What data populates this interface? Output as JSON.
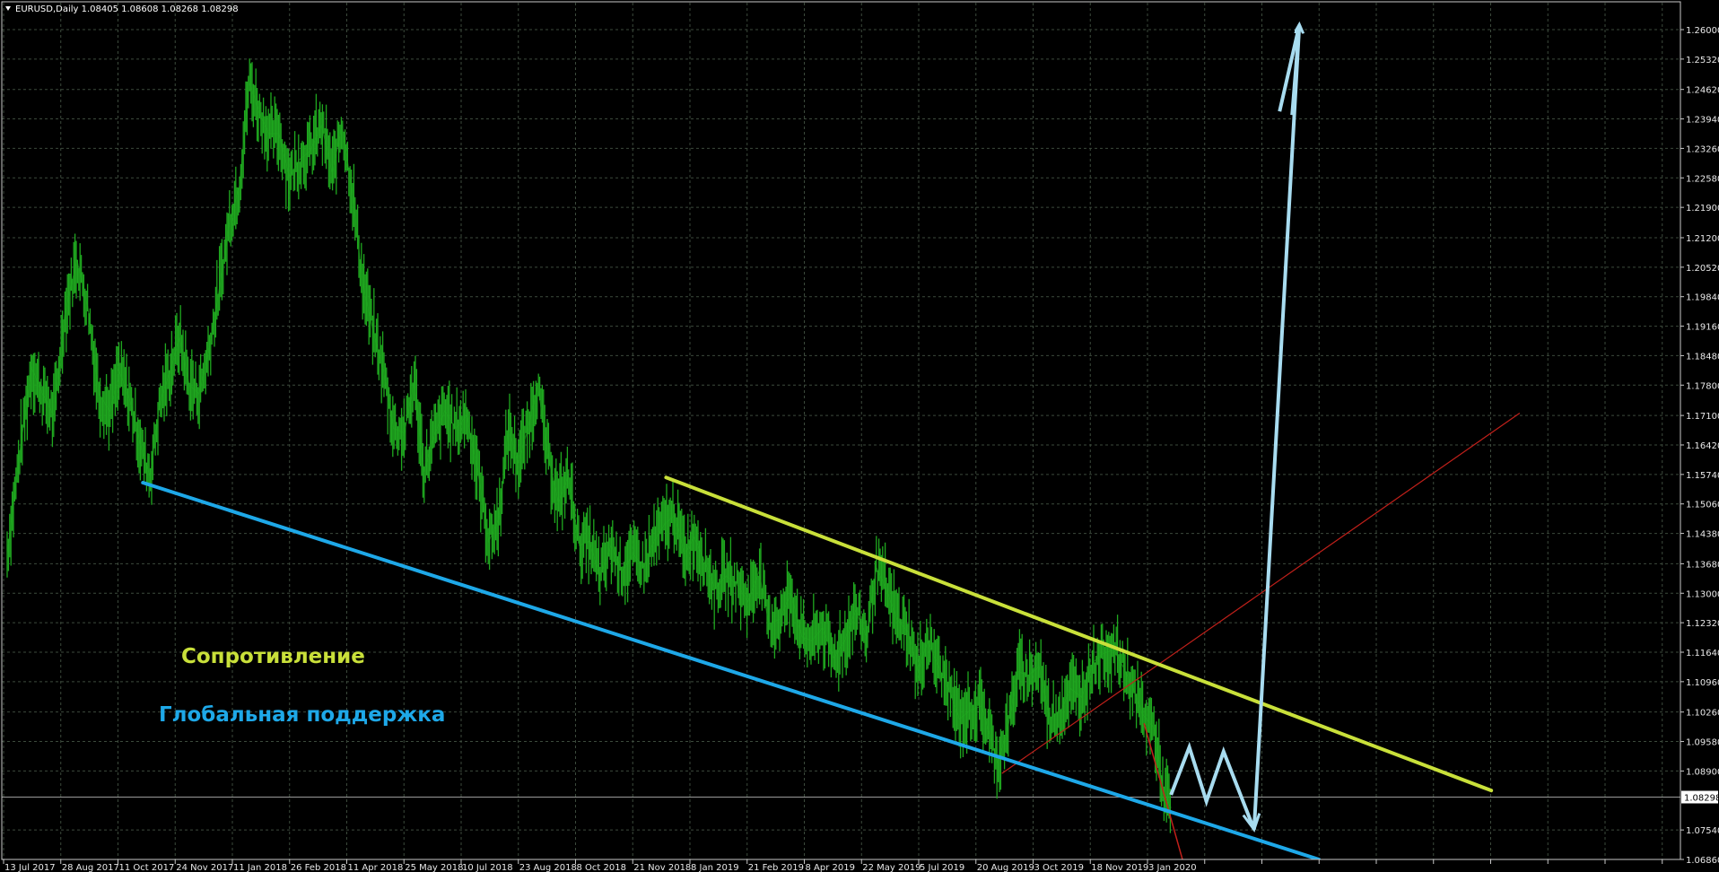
{
  "header": {
    "symbol_line": "EURUSD,Daily  1.08405 1.08608 1.08268 1.08298"
  },
  "colors": {
    "background": "#000000",
    "grid": "#3c4a3c",
    "axis": "#c8c8c8",
    "price": "#1fa81f",
    "resistance": "#c9e03a",
    "support": "#1ea8e8",
    "forecast": "#a8dcf0",
    "red_line": "#c0201a",
    "current_price_line": "#9a9a9a"
  },
  "annotations": {
    "resistance": "Сопротивление",
    "support": "Глобальная поддержка"
  },
  "current_price": "1.08298",
  "chart_data": {
    "type": "line",
    "symbol": "EURUSD",
    "timeframe": "Daily",
    "ohlc_last": {
      "open": 1.08405,
      "high": 1.08608,
      "low": 1.08268,
      "close": 1.08298
    },
    "y_ticks": [
      "1.26000",
      "1.25320",
      "1.24620",
      "1.23940",
      "1.23260",
      "1.22580",
      "1.21900",
      "1.21200",
      "1.20520",
      "1.19840",
      "1.19160",
      "1.18480",
      "1.17800",
      "1.17100",
      "1.16420",
      "1.15740",
      "1.15060",
      "1.14380",
      "1.13680",
      "1.13000",
      "1.12320",
      "1.11640",
      "1.10960",
      "1.10260",
      "1.09580",
      "1.08900",
      "1.08298",
      "1.07540",
      "1.06860"
    ],
    "x_ticks": [
      "13 Jul 2017",
      "28 Aug 2017",
      "11 Oct 2017",
      "24 Nov 2017",
      "11 Jan 2018",
      "26 Feb 2018",
      "11 Apr 2018",
      "25 May 2018",
      "10 Jul 2018",
      "23 Aug 2018",
      "8 Oct 2018",
      "21 Nov 2018",
      "8 Jan 2019",
      "21 Feb 2019",
      "8 Apr 2019",
      "22 May 2019",
      "5 Jul 2019",
      "20 Aug 2019",
      "3 Oct 2019",
      "18 Nov 2019",
      "3 Jan 2020"
    ],
    "ylim": [
      1.0686,
      1.2628
    ],
    "grid": true,
    "series": [
      {
        "values": [
          [
            "2017-07-13",
            1.139
          ],
          [
            "2017-07-24",
            1.164
          ],
          [
            "2017-08-02",
            1.182
          ],
          [
            "2017-08-11",
            1.176
          ],
          [
            "2017-08-20",
            1.171
          ],
          [
            "2017-08-29",
            1.194
          ],
          [
            "2017-09-08",
            1.207
          ],
          [
            "2017-09-17",
            1.196
          ],
          [
            "2017-09-26",
            1.176
          ],
          [
            "2017-10-05",
            1.172
          ],
          [
            "2017-10-13",
            1.181
          ],
          [
            "2017-10-22",
            1.174
          ],
          [
            "2017-10-31",
            1.163
          ],
          [
            "2017-11-07",
            1.157
          ],
          [
            "2017-11-15",
            1.174
          ],
          [
            "2017-11-23",
            1.181
          ],
          [
            "2017-12-01",
            1.189
          ],
          [
            "2017-12-09",
            1.178
          ],
          [
            "2017-12-17",
            1.176
          ],
          [
            "2017-12-25",
            1.186
          ],
          [
            "2018-01-03",
            1.201
          ],
          [
            "2018-01-11",
            1.216
          ],
          [
            "2018-01-19",
            1.224
          ],
          [
            "2018-01-27",
            1.248
          ],
          [
            "2018-02-04",
            1.241
          ],
          [
            "2018-02-12",
            1.236
          ],
          [
            "2018-02-20",
            1.236
          ],
          [
            "2018-03-01",
            1.226
          ],
          [
            "2018-03-09",
            1.23
          ],
          [
            "2018-03-18",
            1.232
          ],
          [
            "2018-03-27",
            1.238
          ],
          [
            "2018-04-05",
            1.227
          ],
          [
            "2018-04-13",
            1.238
          ],
          [
            "2018-04-22",
            1.221
          ],
          [
            "2018-04-30",
            1.201
          ],
          [
            "2018-05-08",
            1.191
          ],
          [
            "2018-05-17",
            1.181
          ],
          [
            "2018-05-25",
            1.168
          ],
          [
            "2018-06-03",
            1.167
          ],
          [
            "2018-06-11",
            1.179
          ],
          [
            "2018-06-19",
            1.158
          ],
          [
            "2018-06-28",
            1.167
          ],
          [
            "2018-07-06",
            1.172
          ],
          [
            "2018-07-15",
            1.168
          ],
          [
            "2018-07-24",
            1.171
          ],
          [
            "2018-08-02",
            1.158
          ],
          [
            "2018-08-11",
            1.142
          ],
          [
            "2018-08-19",
            1.147
          ],
          [
            "2018-08-27",
            1.168
          ],
          [
            "2018-09-04",
            1.16
          ],
          [
            "2018-09-12",
            1.168
          ],
          [
            "2018-09-20",
            1.178
          ],
          [
            "2018-09-28",
            1.162
          ],
          [
            "2018-10-07",
            1.151
          ],
          [
            "2018-10-15",
            1.157
          ],
          [
            "2018-10-24",
            1.141
          ],
          [
            "2018-11-01",
            1.142
          ],
          [
            "2018-11-10",
            1.134
          ],
          [
            "2018-11-19",
            1.141
          ],
          [
            "2018-11-28",
            1.135
          ],
          [
            "2018-12-07",
            1.139
          ],
          [
            "2018-12-16",
            1.136
          ],
          [
            "2018-12-24",
            1.142
          ],
          [
            "2019-01-02",
            1.146
          ],
          [
            "2019-01-10",
            1.148
          ],
          [
            "2019-01-18",
            1.139
          ],
          [
            "2019-01-26",
            1.143
          ],
          [
            "2019-02-04",
            1.137
          ],
          [
            "2019-02-12",
            1.131
          ],
          [
            "2019-02-21",
            1.134
          ],
          [
            "2019-03-02",
            1.132
          ],
          [
            "2019-03-11",
            1.128
          ],
          [
            "2019-03-20",
            1.135
          ],
          [
            "2019-03-28",
            1.123
          ],
          [
            "2019-04-06",
            1.124
          ],
          [
            "2019-04-15",
            1.13
          ],
          [
            "2019-04-24",
            1.12
          ],
          [
            "2019-05-02",
            1.119
          ],
          [
            "2019-05-11",
            1.122
          ],
          [
            "2019-05-20",
            1.115
          ],
          [
            "2019-05-29",
            1.119
          ],
          [
            "2019-06-07",
            1.126
          ],
          [
            "2019-06-16",
            1.12
          ],
          [
            "2019-06-24",
            1.136
          ],
          [
            "2019-07-02",
            1.131
          ],
          [
            "2019-07-11",
            1.124
          ],
          [
            "2019-07-20",
            1.121
          ],
          [
            "2019-07-28",
            1.112
          ],
          [
            "2019-08-05",
            1.119
          ],
          [
            "2019-08-14",
            1.113
          ],
          [
            "2019-08-22",
            1.108
          ],
          [
            "2019-08-31",
            1.101
          ],
          [
            "2019-09-09",
            1.103
          ],
          [
            "2019-09-18",
            1.104
          ],
          [
            "2019-09-27",
            1.095
          ],
          [
            "2019-10-01",
            1.091
          ],
          [
            "2019-10-09",
            1.098
          ],
          [
            "2019-10-18",
            1.112
          ],
          [
            "2019-10-26",
            1.111
          ],
          [
            "2019-11-04",
            1.113
          ],
          [
            "2019-11-13",
            1.101
          ],
          [
            "2019-11-22",
            1.103
          ],
          [
            "2019-11-30",
            1.108
          ],
          [
            "2019-12-09",
            1.106
          ],
          [
            "2019-12-18",
            1.114
          ],
          [
            "2019-12-26",
            1.116
          ],
          [
            "2020-01-04",
            1.117
          ],
          [
            "2020-01-12",
            1.113
          ],
          [
            "2020-01-20",
            1.108
          ],
          [
            "2020-01-28",
            1.102
          ],
          [
            "2020-02-06",
            1.099
          ],
          [
            "2020-02-14",
            1.084
          ],
          [
            "2020-02-20",
            1.0805
          ]
        ]
      }
    ],
    "resistance_line": [
      [
        "2019-01-03",
        1.1567
      ],
      [
        "2020-11-08",
        1.0845
      ]
    ],
    "support_line": [
      [
        "2017-11-01",
        1.1555
      ],
      [
        "2020-06-20",
        1.0686
      ]
    ],
    "red_line": [
      [
        "2019-10-05",
        1.0885
      ],
      [
        "2020-12-01",
        1.1715
      ]
    ],
    "forecast_path": [
      [
        "2020-02-20",
        1.0835
      ],
      [
        "2020-03-06",
        1.0945
      ],
      [
        "2020-03-20",
        1.082
      ],
      [
        "2020-04-03",
        1.0935
      ],
      [
        "2020-04-28",
        1.0755
      ],
      [
        "2020-06-04",
        1.261
      ]
    ]
  }
}
